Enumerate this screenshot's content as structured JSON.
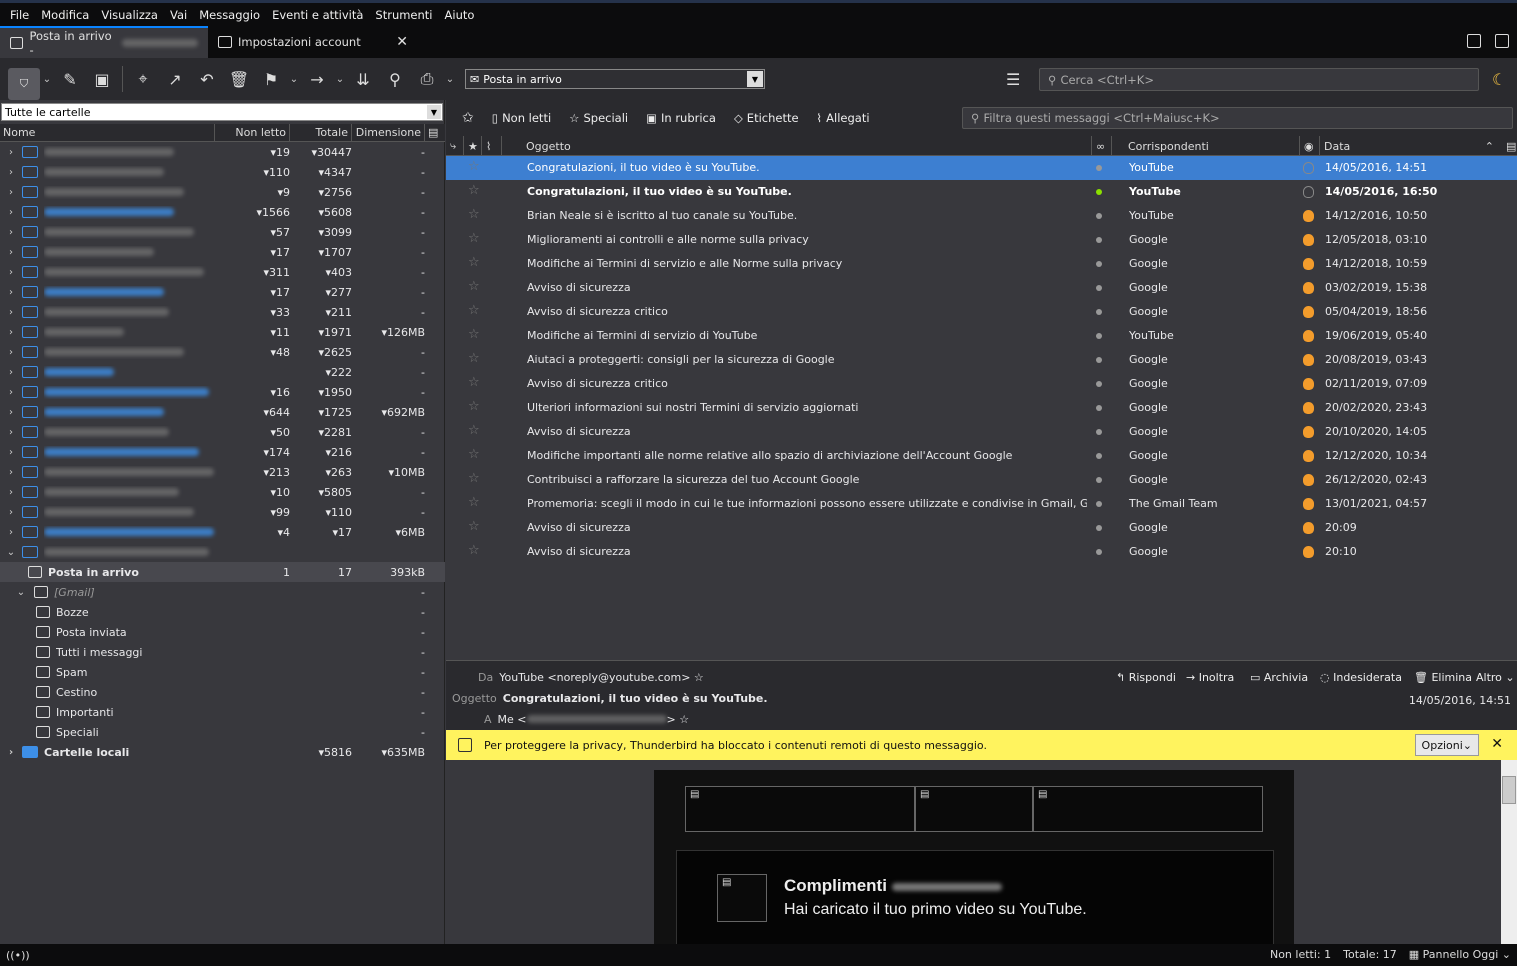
{
  "menu": [
    "File",
    "Modifica",
    "Visualizza",
    "Vai",
    "Messaggio",
    "Eventi e attività",
    "Strumenti",
    "Aiuto"
  ],
  "tabs": [
    {
      "label": "Posta in arrivo -"
    },
    {
      "label": "Impostazioni account",
      "close": "✕"
    }
  ],
  "toolbar": {
    "folder_select": "Posta in arrivo",
    "search_placeholder": "Cerca <Ctrl+K>"
  },
  "folder_pane": {
    "selector": "Tutte le cartelle",
    "cols": [
      "Nome",
      "Non letto",
      "Totale",
      "Dimensione"
    ],
    "accounts": [
      {
        "unread": "19",
        "total": "30447",
        "size": "-"
      },
      {
        "unread": "110",
        "total": "4347",
        "size": "-"
      },
      {
        "unread": "9",
        "total": "2756",
        "size": "-"
      },
      {
        "unread": "1566",
        "total": "5608",
        "size": "-"
      },
      {
        "unread": "57",
        "total": "3099",
        "size": "-"
      },
      {
        "unread": "17",
        "total": "1707",
        "size": "-"
      },
      {
        "unread": "311",
        "total": "403",
        "size": "-"
      },
      {
        "unread": "17",
        "total": "277",
        "size": "-"
      },
      {
        "unread": "33",
        "total": "211",
        "size": "-"
      },
      {
        "unread": "11",
        "total": "1971",
        "size": "126MB"
      },
      {
        "unread": "48",
        "total": "2625",
        "size": "-"
      },
      {
        "unread": "",
        "total": "222",
        "size": "-"
      },
      {
        "unread": "16",
        "total": "1950",
        "size": "-"
      },
      {
        "unread": "644",
        "total": "1725",
        "size": "692MB"
      },
      {
        "unread": "50",
        "total": "2281",
        "size": "-"
      },
      {
        "unread": "174",
        "total": "216",
        "size": "-"
      },
      {
        "unread": "213",
        "total": "263",
        "size": "10MB"
      },
      {
        "unread": "10",
        "total": "5805",
        "size": "-"
      },
      {
        "unread": "99",
        "total": "110",
        "size": "-"
      },
      {
        "unread": "4",
        "total": "17",
        "size": "6MB"
      }
    ],
    "inbox": {
      "name": "Posta in arrivo",
      "unread": "1",
      "total": "17",
      "size": "393kB"
    },
    "gmail": "[Gmail]",
    "subfolders": [
      "Bozze",
      "Posta inviata",
      "Tutti i messaggi",
      "Spam",
      "Cestino",
      "Importanti",
      "Speciali"
    ],
    "local": {
      "name": "Cartelle locali",
      "total": "5816",
      "size": "635MB"
    }
  },
  "quickfilter": {
    "items": [
      "Non letti",
      "Speciali",
      "In rubrica",
      "Etichette",
      "Allegati"
    ],
    "placeholder": "Filtra questi messaggi <Ctrl+Maiusc+K>"
  },
  "thread_cols": [
    "Oggetto",
    "Corrispondenti",
    "Data"
  ],
  "messages": [
    {
      "subject": "Congratulazioni, il tuo video è su YouTube.",
      "from": "YouTube",
      "date": "14/05/2016, 14:51"
    },
    {
      "subject": "Congratulazioni, il tuo video è su YouTube.",
      "from": "YouTube",
      "date": "14/05/2016, 16:50"
    },
    {
      "subject": "Brian Neale si è iscritto al tuo canale su YouTube.",
      "from": "YouTube",
      "date": "14/12/2016, 10:50"
    },
    {
      "subject": "Miglioramenti ai controlli e alle norme sulla privacy",
      "from": "Google",
      "date": "12/05/2018, 03:10"
    },
    {
      "subject": "Modifiche ai Termini di servizio e alle Norme sulla privacy",
      "from": "Google",
      "date": "14/12/2018, 10:59"
    },
    {
      "subject": "Avviso di sicurezza",
      "from": "Google",
      "date": "03/02/2019, 15:38"
    },
    {
      "subject": "Avviso di sicurezza critico",
      "from": "Google",
      "date": "05/04/2019, 18:56"
    },
    {
      "subject": "Modifiche ai Termini di servizio di YouTube",
      "from": "YouTube",
      "date": "19/06/2019, 05:40"
    },
    {
      "subject": "Aiutaci a proteggerti: consigli per la sicurezza di Google",
      "from": "Google",
      "date": "20/08/2019, 03:43"
    },
    {
      "subject": "Avviso di sicurezza critico",
      "from": "Google",
      "date": "02/11/2019, 07:09"
    },
    {
      "subject": "Ulteriori informazioni sui nostri Termini di servizio aggiornati",
      "from": "Google",
      "date": "20/02/2020, 23:43"
    },
    {
      "subject": "Avviso di sicurezza",
      "from": "Google",
      "date": "20/10/2020, 14:05"
    },
    {
      "subject": "Modifiche importanti alle norme relative allo spazio di archiviazione dell'Account Google",
      "from": "Google",
      "date": "12/12/2020, 10:34"
    },
    {
      "subject": "Contribuisci a rafforzare la sicurezza del tuo Account Google",
      "from": "Google",
      "date": "26/12/2020, 02:43"
    },
    {
      "subject": "Promemoria: scegli il modo in cui le tue informazioni possono essere utilizzate e condivise in Gmail, Google Chat e Go...",
      "from": "The Gmail Team",
      "date": "13/01/2021, 04:57"
    },
    {
      "subject": "Avviso di sicurezza",
      "from": "Google",
      "date": "20:09"
    },
    {
      "subject": "Avviso di sicurezza",
      "from": "Google",
      "date": "20:10"
    }
  ],
  "header": {
    "from_label": "Da",
    "from": "YouTube <noreply@youtube.com>",
    "subject_label": "Oggetto",
    "subject": "Congratulazioni, il tuo video è su YouTube.",
    "to_label": "A",
    "to": "Me <",
    "to_end": ">",
    "date": "14/05/2016, 14:51",
    "actions": [
      "Rispondi",
      "Inoltra",
      "Archivia",
      "Indesiderata",
      "Elimina",
      "Altro"
    ]
  },
  "notification": {
    "text": "Per proteggere la privacy, Thunderbird ha bloccato i contenuti remoti di questo messaggio.",
    "options": "Opzioni"
  },
  "email": {
    "title": "Complimenti",
    "line": "Hai caricato il tuo primo video su YouTube."
  },
  "status": {
    "unread": "Non letti: 1",
    "total": "Totale: 17",
    "panel": "Pannello Oggi"
  }
}
